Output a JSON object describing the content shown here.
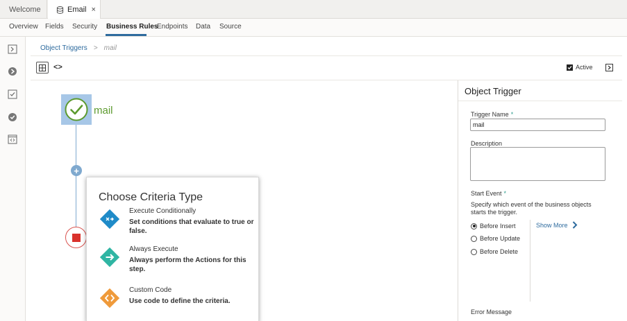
{
  "file_tabs": [
    {
      "label": "Welcome"
    },
    {
      "label": "Email",
      "close": "×"
    }
  ],
  "sub_tabs": [
    "Overview",
    "Fields",
    "Security",
    "Business Rules",
    "Endpoints",
    "Data",
    "Source"
  ],
  "active_sub_tab": "Business Rules",
  "breadcrumb": {
    "link": "Object Triggers",
    "separator": ">",
    "current": "mail"
  },
  "toolbar": {
    "code_label": "<>",
    "active_label": "Active",
    "active_checked": true
  },
  "canvas": {
    "start_label": "mail",
    "add_symbol": "+"
  },
  "popup": {
    "title": "Choose Criteria Type",
    "options": [
      {
        "title": "Execute Conditionally",
        "desc": "Set conditions that evaluate to true or false.",
        "icon": "conditional-icon",
        "color": "#1f8bc8"
      },
      {
        "title": "Always Execute",
        "desc": "Always perform the Actions for this step.",
        "icon": "arrow-right-icon",
        "color": "#2fb5a3"
      },
      {
        "title": "Custom Code",
        "desc": "Use code to define the criteria.",
        "icon": "code-icon",
        "color": "#ef9a3a"
      }
    ]
  },
  "panel": {
    "title": "Object Trigger",
    "trigger_name_label": "Trigger Name",
    "required_mark": "*",
    "trigger_name_value": "mail",
    "description_label": "Description",
    "description_value": "",
    "start_event_label": "Start Event",
    "start_event_hint": "Specify which event of the business objects starts the trigger.",
    "events": [
      {
        "label": "Before Insert",
        "selected": true
      },
      {
        "label": "Before Update",
        "selected": false
      },
      {
        "label": "Before Delete",
        "selected": false
      }
    ],
    "show_more": "Show More",
    "error_message_label": "Error Message"
  },
  "colors": {
    "accent": "#2e6b9e",
    "start_node": "#a7c7e7",
    "success": "#5c9a2e",
    "end": "#d9322c"
  }
}
